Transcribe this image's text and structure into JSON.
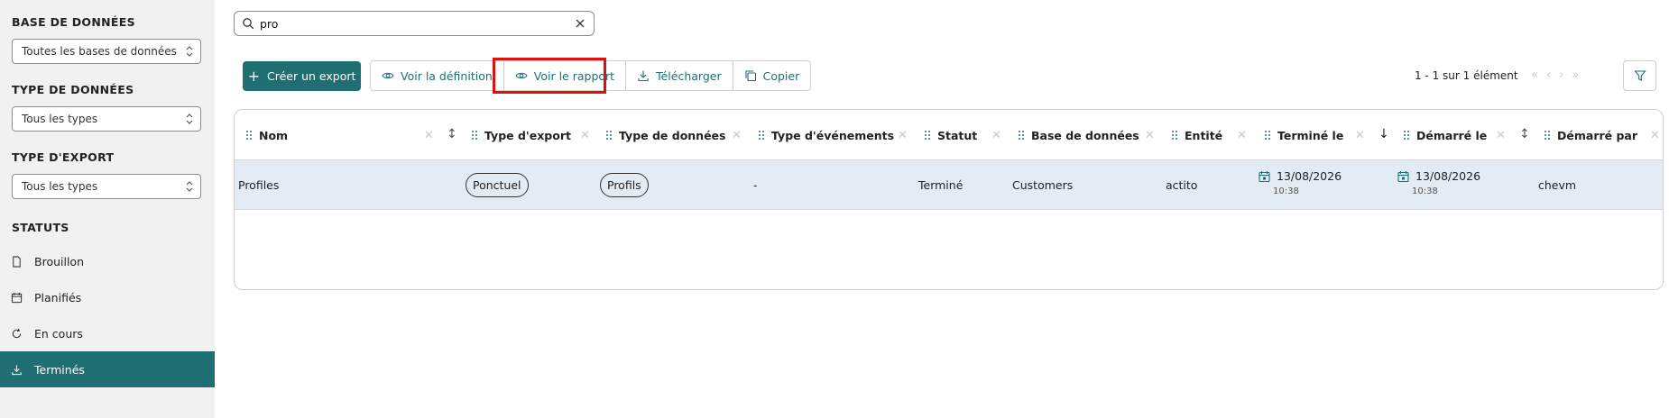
{
  "sidebar": {
    "database_title": "BASE DE DONNÉES",
    "database_select": "Toutes les bases de données",
    "data_type_title": "TYPE DE DONNÉES",
    "data_type_select": "Tous les types",
    "export_type_title": "TYPE D'EXPORT",
    "export_type_select": "Tous les types",
    "statuses_title": "STATUTS",
    "statuses": [
      {
        "label": "Brouillon",
        "icon": "document-icon",
        "active": false
      },
      {
        "label": "Planifiés",
        "icon": "calendar-icon",
        "active": false
      },
      {
        "label": "En cours",
        "icon": "refresh-icon",
        "active": false
      },
      {
        "label": "Terminés",
        "icon": "download-icon",
        "active": true
      }
    ]
  },
  "search": {
    "value": "pro",
    "placeholder": ""
  },
  "toolbar": {
    "create_label": "Créer un export",
    "view_definition_label": "Voir la définition",
    "view_report_label": "Voir le rapport",
    "download_label": "Télécharger",
    "copy_label": "Copier"
  },
  "pagination": {
    "summary": "1 - 1 sur 1 élément"
  },
  "table": {
    "columns": [
      {
        "label": "Nom"
      },
      {
        "label": "Type d'export"
      },
      {
        "label": "Type de données"
      },
      {
        "label": "Type d'événements"
      },
      {
        "label": "Statut"
      },
      {
        "label": "Base de données"
      },
      {
        "label": "Entité"
      },
      {
        "label": "Terminé le"
      },
      {
        "label": "Démarré le"
      },
      {
        "label": "Démarré par"
      }
    ],
    "rows": [
      {
        "nom": "Profiles",
        "type_export": "Ponctuel",
        "type_donnees": "Profils",
        "type_evenements": "-",
        "statut": "Terminé",
        "base": "Customers",
        "entite": "actito",
        "termine_date": "13/08/2026",
        "termine_heure": "10:38",
        "demarre_date": "13/08/2026",
        "demarre_heure": "10:38",
        "demarre_par": "chevm"
      }
    ]
  },
  "colors": {
    "accent": "#1f6f72",
    "highlight": "#e01010",
    "selected_row": "#e3ebf5"
  }
}
